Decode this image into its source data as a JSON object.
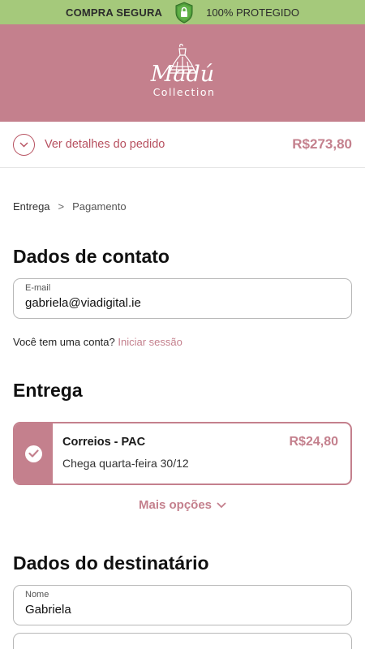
{
  "topbar": {
    "left_text": "COMPRA SEGURA",
    "right_text": "100% PROTEGIDO",
    "shield_icon": "shield-lock-icon",
    "bg_color": "#a5c97b"
  },
  "header": {
    "brand_script": "Madú",
    "brand_sub": "Collection",
    "bg_color": "#c4808d"
  },
  "summary": {
    "toggle_label": "Ver detalhes do pedido",
    "total": "R$273,80"
  },
  "breadcrumb": {
    "step1": "Entrega",
    "sep": ">",
    "step2": "Pagamento"
  },
  "contact": {
    "heading": "Dados de contato",
    "email_label": "E-mail",
    "email_value": "gabriela@viadigital.ie",
    "account_question": "Você tem uma conta?",
    "login_link": "Iniciar sessão"
  },
  "delivery": {
    "heading": "Entrega",
    "option_name": "Correios - PAC",
    "option_eta": "Chega quarta-feira 30/12",
    "option_price": "R$24,80",
    "more_options": "Mais opções"
  },
  "recipient": {
    "heading": "Dados do destinatário",
    "name_label": "Nome",
    "name_value": "Gabriela"
  },
  "colors": {
    "accent": "#c4808d",
    "accent_dark": "#b7505f"
  }
}
